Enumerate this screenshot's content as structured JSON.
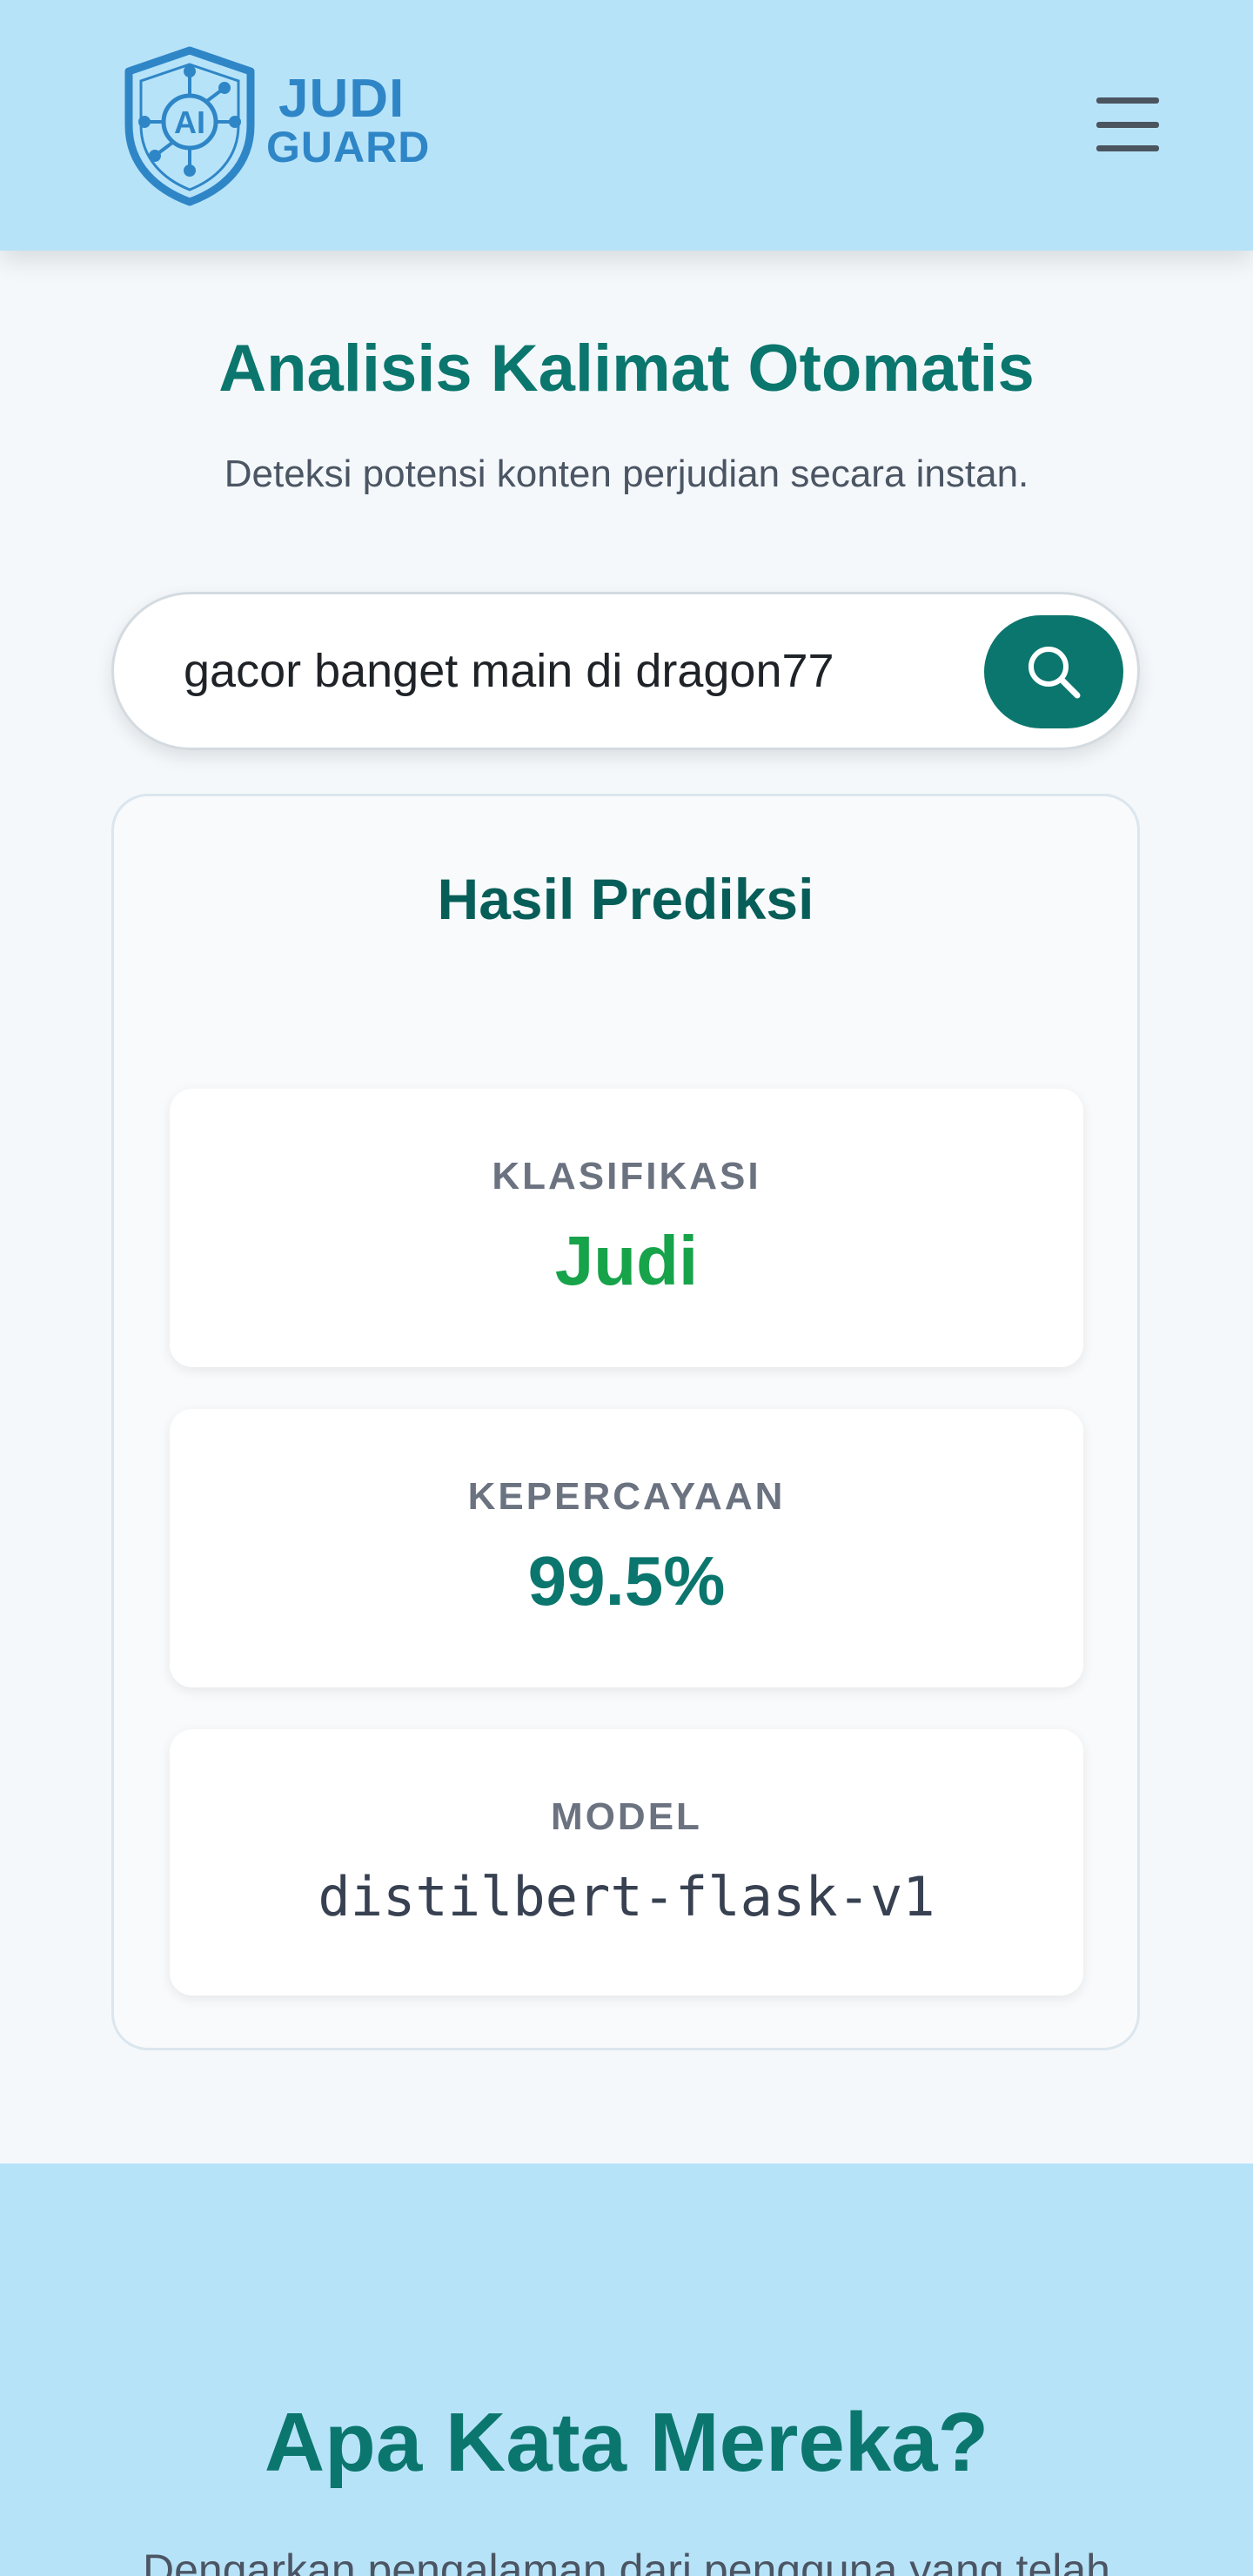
{
  "header": {
    "logo_line1": "JUDI",
    "logo_line2": "GUARD",
    "logo_badge": "AI",
    "menu_icon": "hamburger-menu-icon"
  },
  "intro": {
    "title": "Analisis Kalimat Otomatis",
    "subtitle": "Deteksi potensi konten perjudian secara instan."
  },
  "search": {
    "value": "gacor banget main di dragon77",
    "button_icon": "search-icon"
  },
  "result": {
    "title": "Hasil Prediksi",
    "classification_label": "KLASIFIKASI",
    "classification_value": "Judi",
    "confidence_label": "KEPERCAYAAN",
    "confidence_value": "99.5%",
    "model_label": "MODEL",
    "model_value": "distilbert-flask-v1"
  },
  "testimonials": {
    "title": "Apa Kata Mereka?",
    "subtitle": "Dengarkan pengalaman dari pengguna yang telah"
  },
  "colors": {
    "header_bg": "#b7e3f9",
    "primary_teal": "#0b766d",
    "success_green": "#17a34a",
    "logo_blue": "#2f86c7"
  }
}
